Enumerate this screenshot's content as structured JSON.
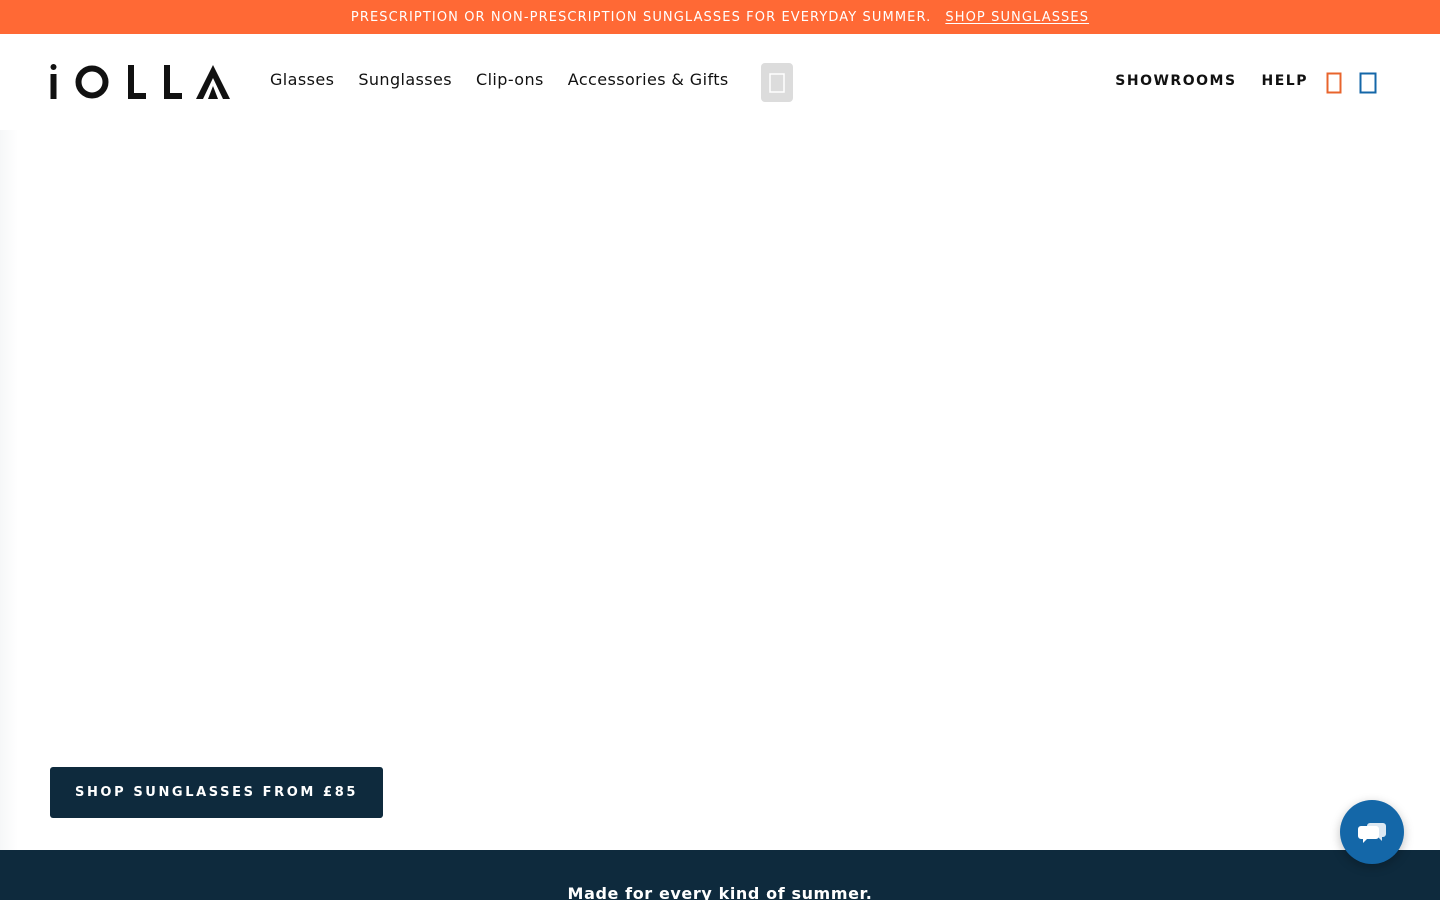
{
  "promo": {
    "text": "PRESCRIPTION OR NON-PRESCRIPTION SUNGLASSES FOR EVERYDAY SUMMER.",
    "link": "SHOP SUNGLASSES"
  },
  "header": {
    "logo": "iOLLA",
    "nav": [
      "Glasses",
      "Sunglasses",
      "Clip-ons",
      "Accessories & Gifts"
    ],
    "right_links": [
      "SHOWROOMS",
      "HELP"
    ]
  },
  "hero": {
    "cta_label": "SHOP SUNGLASSES FROM £85"
  },
  "band": {
    "text": "Made for every kind of summer."
  },
  "colors": {
    "promo_bg": "#ff6935",
    "navy": "#0e2a3d",
    "chat_blue": "#1467a8",
    "account_icon": "#e8642c",
    "bag_icon": "#1467a8"
  },
  "icons": {
    "search": "search-icon",
    "account": "account-icon",
    "bag": "bag-icon",
    "chat": "chat-icon"
  }
}
